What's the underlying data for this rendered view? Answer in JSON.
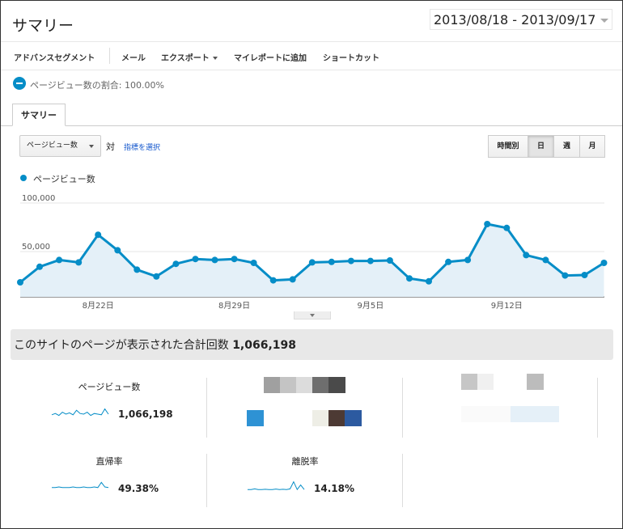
{
  "header": {
    "title": "サマリー",
    "date_range": "2013/08/18 - 2013/09/17"
  },
  "toolbar": {
    "advanced_segments": "アドバンスセグメント",
    "email": "メール",
    "export": "エクスポート",
    "add_to_dashboard": "マイレポートに追加",
    "shortcut": "ショートカット"
  },
  "segment": {
    "text": "ページビュー数の割合: 100.00%"
  },
  "tabs": {
    "summary": "サマリー"
  },
  "controls": {
    "metric_select": "ページビュー数",
    "vs": "対",
    "select_metric": "指標を選択",
    "granularity": [
      "時間別",
      "日",
      "週",
      "月"
    ],
    "active_granularity": "日"
  },
  "colors": {
    "accent": "#058dc7",
    "area_fill": "#e4f0f8",
    "summary_bg": "#e8e8e8"
  },
  "chart_data": {
    "type": "area",
    "series": [
      {
        "name": "ページビュー数",
        "values": [
          15000,
          31000,
          38000,
          35500,
          64000,
          48000,
          28000,
          21000,
          34000,
          39000,
          38000,
          39000,
          35000,
          17000,
          18000,
          35500,
          36000,
          37000,
          37000,
          37500,
          19000,
          16000,
          36000,
          38000,
          75000,
          71000,
          43000,
          38000,
          22000,
          22500,
          35000
        ]
      }
    ],
    "x_tick_labels": [
      "8月22日",
      "8月29日",
      "9月5日",
      "9月12日"
    ],
    "y_tick_labels": [
      "100,000",
      "50,000"
    ],
    "ylim": [
      0,
      100000
    ],
    "grid": true
  },
  "summary": {
    "title": "このサイトのページが表示された合計回数",
    "total": "1,066,198",
    "metrics": [
      {
        "label": "ページビュー数",
        "value": "1,066,198"
      },
      {
        "label": "直帰率",
        "value": "49.38%"
      },
      {
        "label": "離脱率",
        "value": "14.18%"
      }
    ]
  }
}
